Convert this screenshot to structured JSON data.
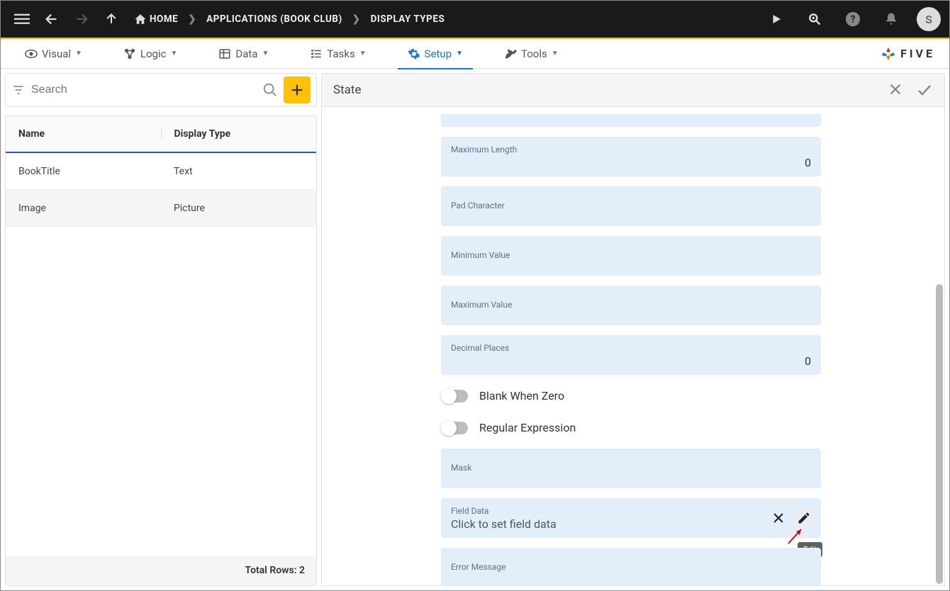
{
  "topbar": {
    "breadcrumbs": [
      "HOME",
      "APPLICATIONS (BOOK CLUB)",
      "DISPLAY TYPES"
    ],
    "avatar_initial": "S"
  },
  "nav": {
    "items": [
      "Visual",
      "Logic",
      "Data",
      "Tasks",
      "Setup",
      "Tools"
    ],
    "active_index": 4,
    "logo_text": "FIVE"
  },
  "sidebar": {
    "search_placeholder": "Search",
    "columns": [
      "Name",
      "Display Type"
    ],
    "rows": [
      {
        "name": "BookTitle",
        "display_type": "Text"
      },
      {
        "name": "Image",
        "display_type": "Picture"
      }
    ],
    "footer_label": "Total Rows:",
    "footer_count": "2"
  },
  "detail": {
    "title": "State",
    "fields": {
      "partial_top_value": "",
      "max_length_label": "Maximum Length",
      "max_length_value": "0",
      "pad_char_label": "Pad Character",
      "pad_char_value": "",
      "min_value_label": "Minimum Value",
      "min_value_value": "",
      "max_value_label": "Maximum Value",
      "max_value_value": "",
      "decimal_label": "Decimal Places",
      "decimal_value": "0",
      "blank_zero_label": "Blank When Zero",
      "regex_label": "Regular Expression",
      "mask_label": "Mask",
      "mask_value": "",
      "field_data_label": "Field Data",
      "field_data_value": "Click to set field data",
      "error_msg_label": "Error Message",
      "error_msg_value": ""
    },
    "tooltip_edit": "Edit"
  }
}
